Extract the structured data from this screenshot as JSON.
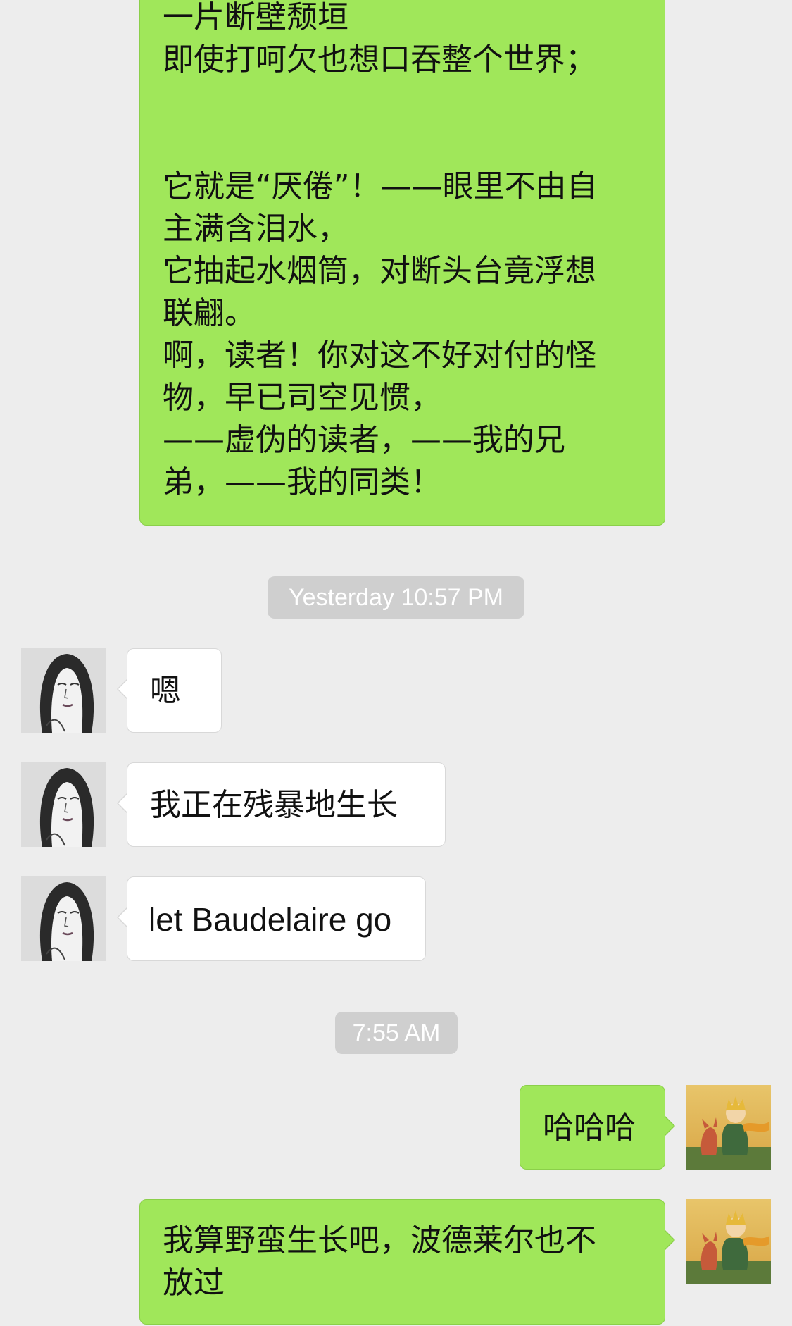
{
  "messages": [
    {
      "lines": [
        "一片断壁颓垣",
        "即使打呵欠也想口吞整个世界；",
        "",
        "",
        "它就是“厌倦”！——眼里不由自",
        "主满含泪水，",
        "它抽起水烟筒，对断头台竟浮想",
        "联翩。",
        "啊，读者！你对这不好对付的怪",
        "物，早已司空见惯，",
        "——虚伪的读者，——我的兄",
        "弟，——我的同类！"
      ]
    },
    {
      "text": "嗯"
    },
    {
      "text": "我正在残暴地生长"
    },
    {
      "text": "let Baudelaire go"
    },
    {
      "text": "哈哈哈"
    },
    {
      "lines": [
        "我算野蛮生长吧，波德莱尔也不",
        "放过"
      ]
    }
  ],
  "timestamps": [
    "Yesterday 10:57 PM",
    "7:55 AM"
  ],
  "avatars": {
    "contact": "sketched-woman-portrait",
    "self": "little-prince-avatar"
  },
  "colors": {
    "background": "#ededed",
    "outgoing_bubble": "#a0e75a",
    "incoming_bubble": "#ffffff",
    "timestamp_bg": "#cfcfcf"
  }
}
